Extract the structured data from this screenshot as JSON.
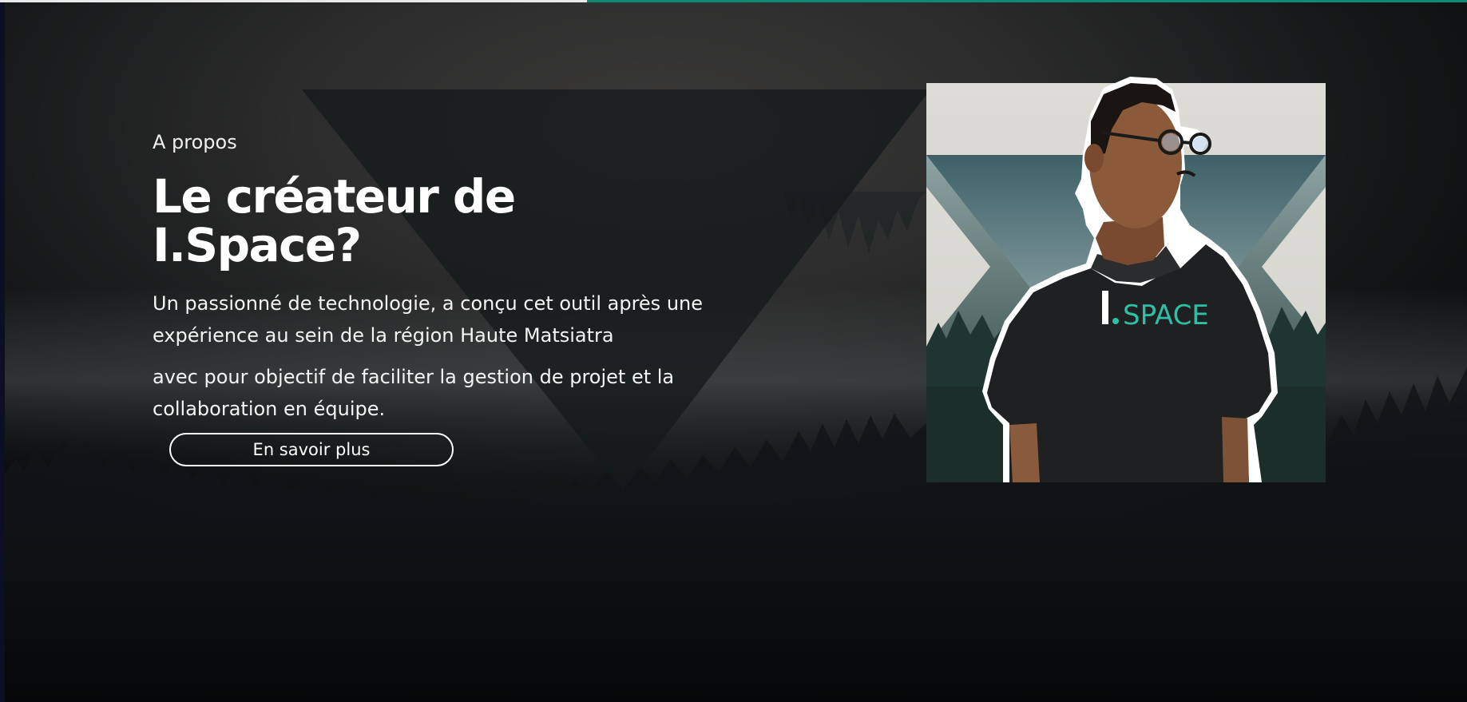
{
  "progress": {
    "fraction": 0.4
  },
  "about": {
    "eyebrow": "A propos",
    "title": "Le créateur de I.Space?",
    "paragraph1": "Un passionné de technologie, a conçu cet outil après une expérience au sein de la région Haute Matsiatra",
    "paragraph2": "avec pour objectif de faciliter la gestion de projet et la collaboration en équipe.",
    "button_label": "En savoir plus"
  },
  "photo": {
    "shirt_logo_left": "I",
    "shirt_logo_right": "SPACE"
  },
  "colors": {
    "accent": "#0f8a73",
    "logo_teal": "#2fbfa5",
    "text": "#ffffff"
  }
}
